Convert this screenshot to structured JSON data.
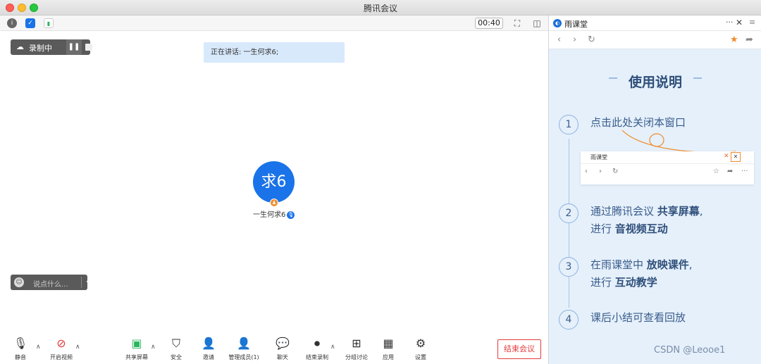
{
  "window": {
    "title": "腾讯会议"
  },
  "statusbar": {
    "timer": "00:40"
  },
  "recording": {
    "label": "录制中"
  },
  "speaking": {
    "text": "正在讲话: 一生何求6;"
  },
  "participant": {
    "avatar_text": "求6",
    "name": "一生何求6"
  },
  "chat": {
    "placeholder": "说点什么..."
  },
  "toolbar": {
    "mute": "静音",
    "video": "开启视频",
    "share": "共享屏幕",
    "security": "安全",
    "invite": "邀请",
    "members": "管理成员(1)",
    "chat": "聊天",
    "end_record": "结束录制",
    "breakout": "分组讨论",
    "apps": "应用",
    "settings": "设置",
    "end_meeting": "结束会议"
  },
  "panel": {
    "title": "雨课堂",
    "guide_title": "使用说明",
    "mock_title": "雨课堂",
    "steps": [
      {
        "num": "1",
        "text": "点击此处关闭本窗口"
      },
      {
        "num": "2",
        "line1_a": "通过腾讯会议 ",
        "line1_b": "共享屏幕",
        "line1_c": ",",
        "line2_a": "进行 ",
        "line2_b": "音视频互动"
      },
      {
        "num": "3",
        "line1_a": "在雨课堂中 ",
        "line1_b": "放映课件",
        "line1_c": ",",
        "line2_a": "进行 ",
        "line2_b": "互动教学"
      },
      {
        "num": "4",
        "text": "课后小结可查看回放"
      }
    ]
  },
  "watermark": "CSDN @Leooe1",
  "colors": {
    "accent": "#1a73e8",
    "end": "#e23b3b",
    "panel_bg": "#e5f0fb",
    "recording_bar": "#5a5a5a"
  }
}
